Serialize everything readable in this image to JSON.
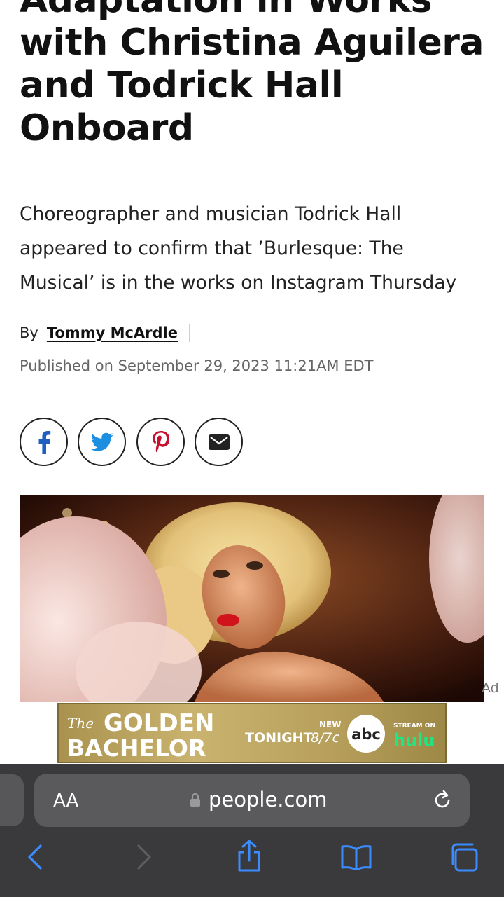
{
  "article": {
    "headline_lines": [
      "Adaptation in Works",
      "with Christina Aguilera",
      "and Todrick Hall",
      "Onboard"
    ],
    "dek_lines": [
      "Choreographer and musician Todrick Hall",
      "appeared to confirm that ’Burlesque: The",
      "Musical’ is in the works on Instagram Thursday"
    ],
    "byline_prefix": "By",
    "author": "Tommy McArdle",
    "published": "Published on September 29, 2023 11:21AM EDT"
  },
  "share_buttons": [
    {
      "icon": "facebook-icon"
    },
    {
      "icon": "twitter-icon"
    },
    {
      "icon": "pinterest-icon"
    },
    {
      "icon": "email-icon"
    }
  ],
  "ad": {
    "label": "Ad",
    "banner": {
      "title_line1": "GOLDEN",
      "title_prefix": "The",
      "title_line2": "BACHELOR",
      "tonight": "TONIGHT",
      "time": "8/7c",
      "new": "NEW",
      "network": "abc",
      "stream_on": "STREAM ON",
      "streamer": "hulu"
    }
  },
  "browser": {
    "aa": "AA",
    "domain": "people.com",
    "toolbar": [
      "back-icon",
      "forward-icon",
      "share-icon",
      "bookmarks-icon",
      "tabs-icon"
    ]
  },
  "colors": {
    "toolbar_bg": "#3a3a3c",
    "toolbar_icon": "#3b8cff",
    "pinterest": "#c8102e",
    "twitter": "#1da1f2",
    "facebook": "#1877f2",
    "banner_gold": "#c9b36e"
  }
}
